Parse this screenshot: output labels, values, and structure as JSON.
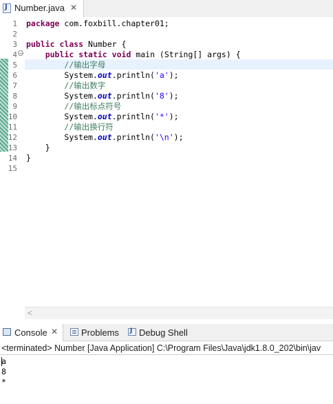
{
  "editor": {
    "tab_title": "Number.java",
    "close_glyph": "✕",
    "line_numbers": [
      "1",
      "2",
      "3",
      "4",
      "5",
      "6",
      "7",
      "8",
      "9",
      "10",
      "11",
      "12",
      "13",
      "14",
      "15"
    ],
    "fold_glyph": "−",
    "code": {
      "l1_kw": "package",
      "l1_rest": " com.foxbill.chapter01;",
      "l3_kw1": "public",
      "l3_kw2": "class",
      "l3_rest": " Number {",
      "l4_kw1": "public",
      "l4_kw2": "static",
      "l4_kw3": "void",
      "l4_rest": " main (String[] args) {",
      "l5_comment": "//输出字母",
      "l6_a": "System.",
      "l6_out": "out",
      "l6_b": ".println(",
      "l6_str": "'a'",
      "l6_c": ");",
      "l7_comment": "//输出数字",
      "l8_a": "System.",
      "l8_out": "out",
      "l8_b": ".println(",
      "l8_str": "'8'",
      "l8_c": ");",
      "l9_comment": "//输出标点符号",
      "l10_a": "System.",
      "l10_out": "out",
      "l10_b": ".println(",
      "l10_str": "'*'",
      "l10_c": ");",
      "l11_comment": "//输出换行符",
      "l12_a": "System.",
      "l12_out": "out",
      "l12_b": ".println(",
      "l12_str": "'\\n'",
      "l12_c": ");",
      "l13": "}",
      "l14": "}"
    },
    "scroll_left_glyph": "<"
  },
  "views": {
    "tabs": [
      {
        "label": "Console",
        "icon": "console-icon"
      },
      {
        "label": "Problems",
        "icon": "problems-icon"
      },
      {
        "label": "Debug Shell",
        "icon": "debug-shell-icon"
      }
    ],
    "close_glyph": "✕"
  },
  "console": {
    "status": "<terminated> Number [Java Application] C:\\Program Files\\Java\\jdk1.8.0_202\\bin\\jav",
    "output_lines": [
      "a",
      "8",
      "*"
    ]
  },
  "colors": {
    "keyword": "#7f0055",
    "comment": "#3f7f5f",
    "field": "#0000c0",
    "string": "#2a00ff",
    "current_line": "#e8f2fe"
  }
}
